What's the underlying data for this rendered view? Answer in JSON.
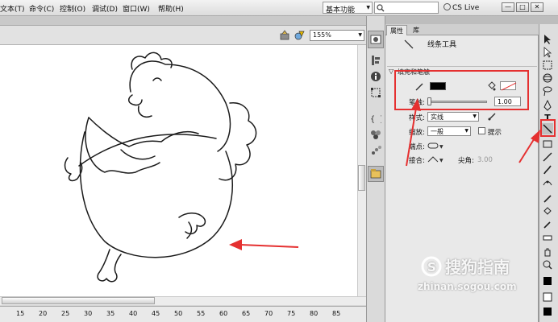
{
  "menubar": {
    "items": [
      {
        "label": "文本(T)"
      },
      {
        "label": "命令(C)"
      },
      {
        "label": "控制(O)"
      },
      {
        "label": "调试(D)"
      },
      {
        "label": "窗口(W)"
      },
      {
        "label": "帮助(H)"
      }
    ],
    "workspace": "基本功能",
    "cslive": "CS Live"
  },
  "stagebar": {
    "zoom": "155%"
  },
  "properties": {
    "tabs": [
      {
        "label": "属性"
      },
      {
        "label": "库"
      }
    ],
    "tool_title": "线条工具",
    "fill_stroke_header": "填充和笔触",
    "stroke_label": "笔触:",
    "stroke_value": "1.00",
    "style_label": "样式:",
    "style_value": "实线",
    "scale_label": "缩放:",
    "scale_value": "一般",
    "hint_label": "提示",
    "cap_label": "端点:",
    "join_label": "接合:",
    "miter_label": "尖角:",
    "miter_value": "3.00"
  },
  "ruler": [
    "15",
    "20",
    "25",
    "30",
    "35",
    "40",
    "45",
    "50",
    "55",
    "60",
    "65",
    "70",
    "75",
    "80",
    "85"
  ],
  "watermark": {
    "brand": "搜狗指南",
    "url": "zhinan.sogou.com"
  },
  "colors": {
    "highlight": "#e53030",
    "stroke_color": "#000000"
  }
}
